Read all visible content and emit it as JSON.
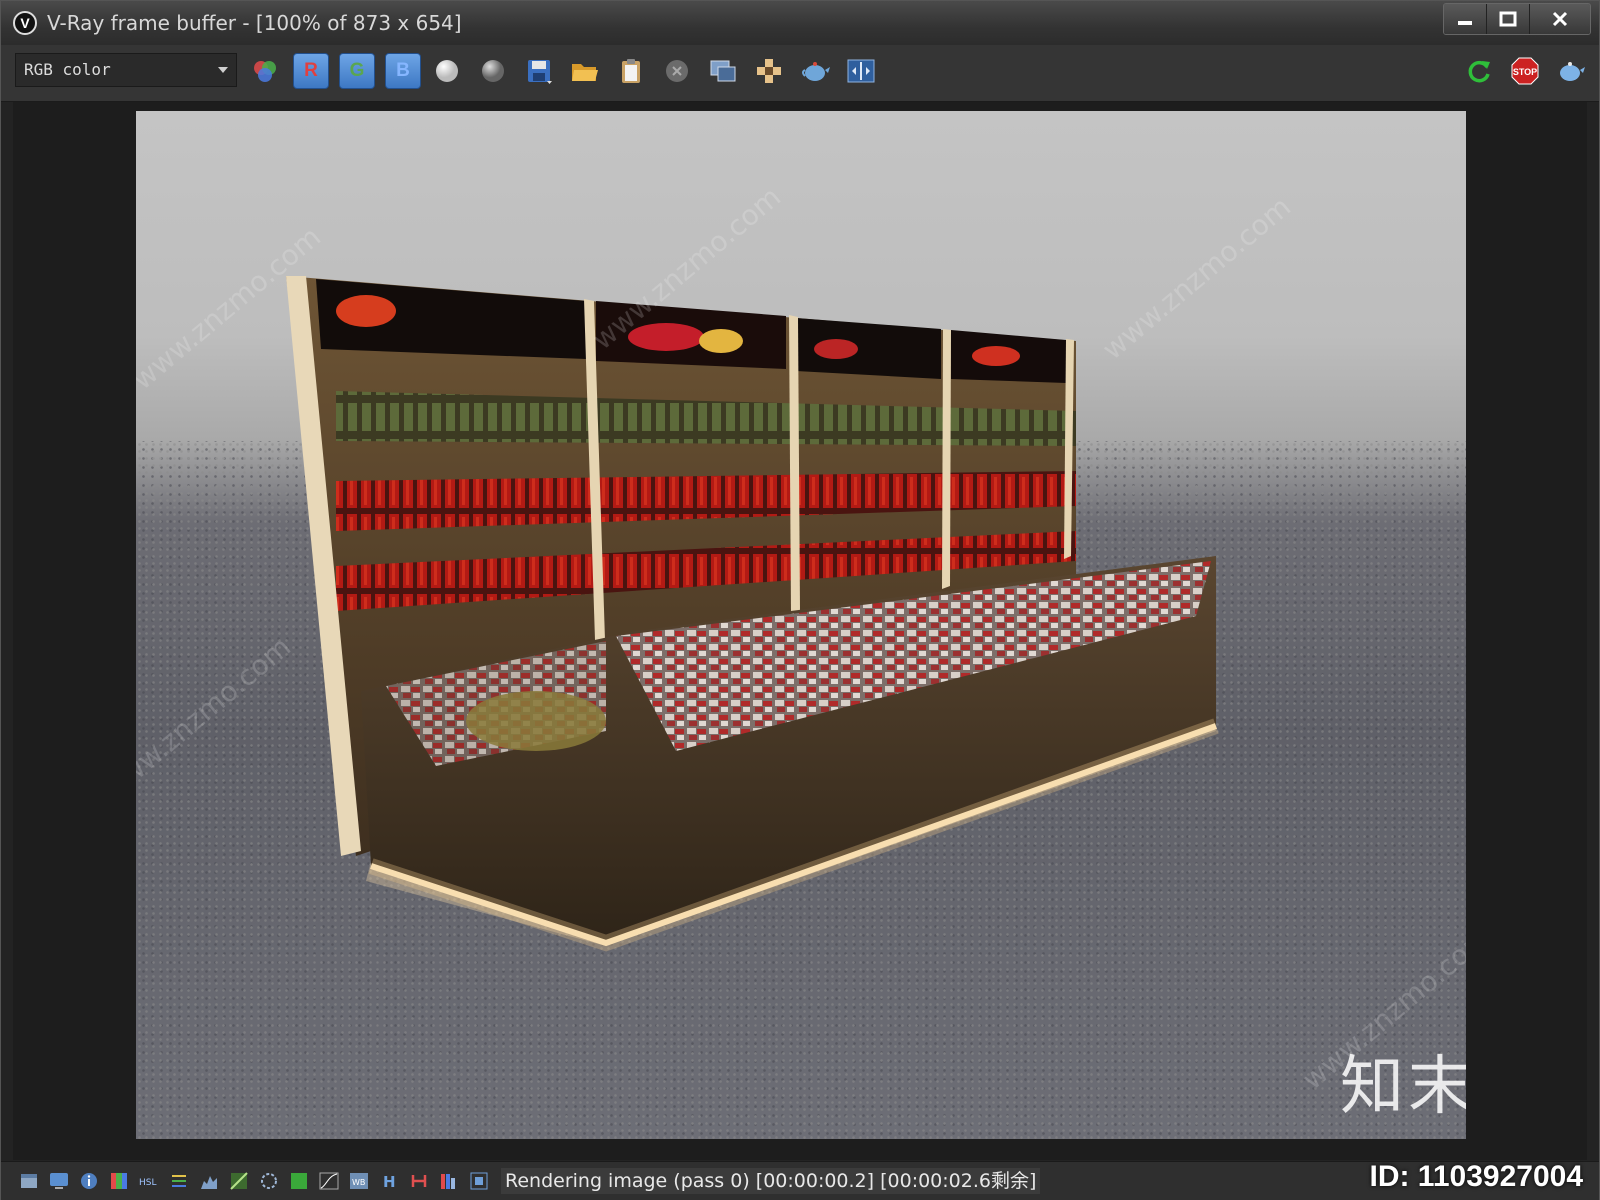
{
  "window": {
    "title": "V-Ray frame buffer - [100% of 873 x 654]",
    "app_icon": "vray-logo-icon"
  },
  "toolbar": {
    "channel_value": "RGB color",
    "buttons": [
      {
        "name": "color-channels-icon"
      },
      {
        "name": "red-channel-button",
        "label": "R"
      },
      {
        "name": "green-channel-button",
        "label": "G"
      },
      {
        "name": "blue-channel-button",
        "label": "B"
      },
      {
        "name": "white-sphere-icon"
      },
      {
        "name": "gray-sphere-icon"
      },
      {
        "name": "save-icon"
      },
      {
        "name": "open-folder-icon"
      },
      {
        "name": "clipboard-icon"
      },
      {
        "name": "clear-icon"
      },
      {
        "name": "copy-window-icon"
      },
      {
        "name": "region-icon"
      },
      {
        "name": "teapot-icon"
      },
      {
        "name": "compare-icon"
      },
      {
        "name": "refresh-icon"
      },
      {
        "name": "stop-icon",
        "label": "STOP"
      },
      {
        "name": "render-teapot-icon"
      }
    ]
  },
  "viewer": {
    "watermark_url": "www.znzmo.com",
    "watermark_cn": "知末网",
    "watermark_logo": "知末"
  },
  "statusbar": {
    "text": "Rendering image (pass 0) [00:00:00.2] [00:00:02.6剩余]",
    "id_text": "ID: 1103927004",
    "icons": [
      "window-icon",
      "monitor-icon",
      "info-icon",
      "levels-icon",
      "hsl-icon",
      "balance-icon",
      "histogram-icon",
      "lut-icon",
      "ocio-icon",
      "color-swatch-icon",
      "curve-icon",
      "exposure-icon",
      "h-icon",
      "h-split-icon",
      "bars-icon",
      "pixel-icon"
    ]
  },
  "colors": {
    "accent": "#3d78c4",
    "stop": "#cc2222",
    "refresh": "#2fbf3a"
  }
}
